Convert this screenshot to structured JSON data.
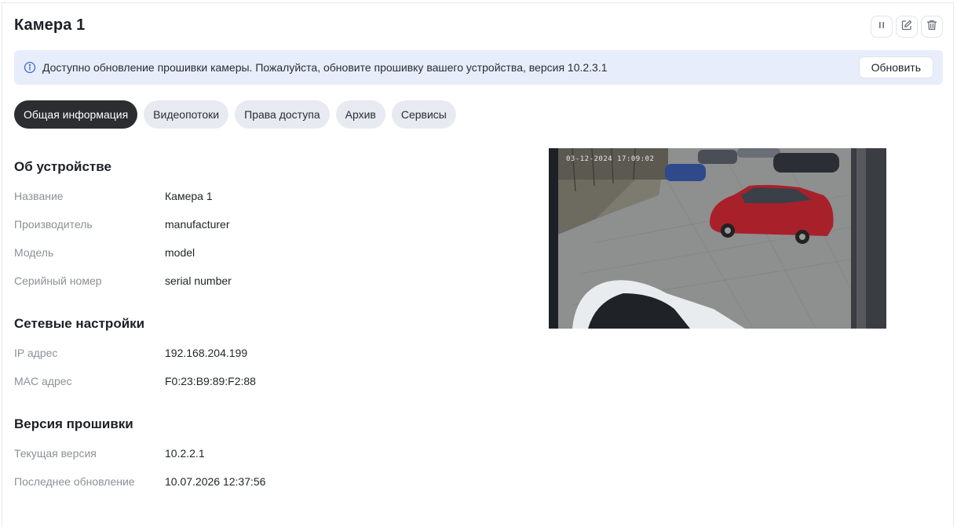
{
  "header": {
    "title": "Камера 1",
    "actions": {
      "pause": "pause-icon",
      "edit": "edit-icon",
      "delete": "trash-icon"
    }
  },
  "banner": {
    "icon": "info-icon",
    "message": "Доступно обновление прошивки камеры. Пожалуйста, обновите прошивку вашего устройства, версия 10.2.3.1",
    "button_label": "Обновить"
  },
  "tabs": [
    {
      "label": "Общая информация",
      "active": true
    },
    {
      "label": "Видеопотоки",
      "active": false
    },
    {
      "label": "Права доступа",
      "active": false
    },
    {
      "label": "Архив",
      "active": false
    },
    {
      "label": "Сервисы",
      "active": false
    }
  ],
  "device": {
    "title": "Об устройстве",
    "rows": [
      {
        "label": "Название",
        "value": "Камера 1"
      },
      {
        "label": "Производитель",
        "value": "manufacturer"
      },
      {
        "label": "Модель",
        "value": "model"
      },
      {
        "label": "Серийный номер",
        "value": "serial number"
      }
    ]
  },
  "network": {
    "title": "Сетевые настройки",
    "rows": [
      {
        "label": "IP адрес",
        "value": "192.168.204.199"
      },
      {
        "label": "MAC адрес",
        "value": "F0:23:B9:89:F2:88"
      }
    ]
  },
  "firmware": {
    "title": "Версия прошивки",
    "rows": [
      {
        "label": "Текущая версия",
        "value": "10.2.2.1"
      },
      {
        "label": "Последнее обновление",
        "value": "10.07.2026 12:37:56"
      }
    ]
  },
  "preview": {
    "timestamp": "03-12-2024 17:09:02"
  },
  "colors": {
    "banner_bg": "#e8edfb",
    "info_icon": "#3b6fd8",
    "tab_active": "#2b2d31",
    "tab_inactive": "#e8eaf2"
  }
}
